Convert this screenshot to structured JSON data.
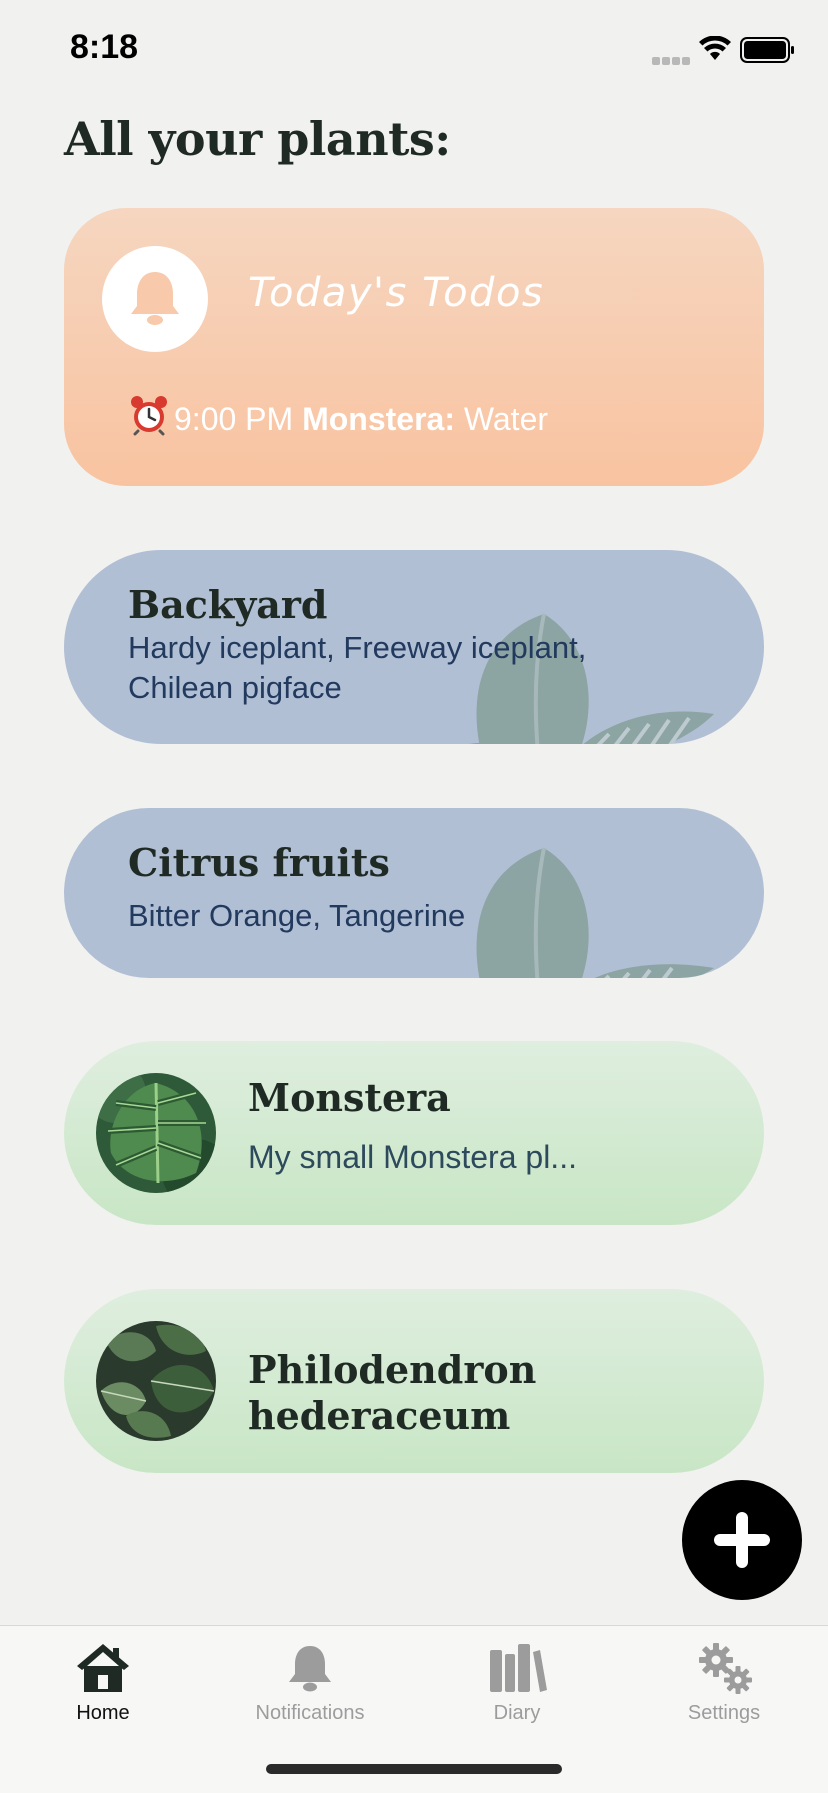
{
  "status_bar": {
    "time": "8:18"
  },
  "page": {
    "title": "All your plants:"
  },
  "todos": {
    "title": "Today's Todos",
    "items": [
      {
        "time": "9:00 PM",
        "plant": "Monstera:",
        "task": "Water"
      }
    ]
  },
  "groups": [
    {
      "name": "Backyard",
      "plants": "Hardy iceplant, Freeway iceplant, Chilean pigface"
    },
    {
      "name": "Citrus fruits",
      "plants": "Bitter Orange, Tangerine"
    }
  ],
  "plants": [
    {
      "name": "Monstera",
      "description": "My small Monstera pl..."
    },
    {
      "name": "Philodendron hederaceum",
      "description": ""
    }
  ],
  "tab_bar": {
    "tabs": [
      {
        "label": "Home",
        "icon": "home-icon",
        "active": true
      },
      {
        "label": "Notifications",
        "icon": "bell-icon",
        "active": false
      },
      {
        "label": "Diary",
        "icon": "books-icon",
        "active": false
      },
      {
        "label": "Settings",
        "icon": "gears-icon",
        "active": false
      }
    ]
  },
  "colors": {
    "background": "#f1f2ef",
    "todo_card": "#f8c3a0",
    "group_card": "#b1bfd5",
    "plant_card": "#c8e6c5",
    "fab": "#000000",
    "tab_active": "#111111",
    "tab_inactive": "#9c9c9c"
  }
}
